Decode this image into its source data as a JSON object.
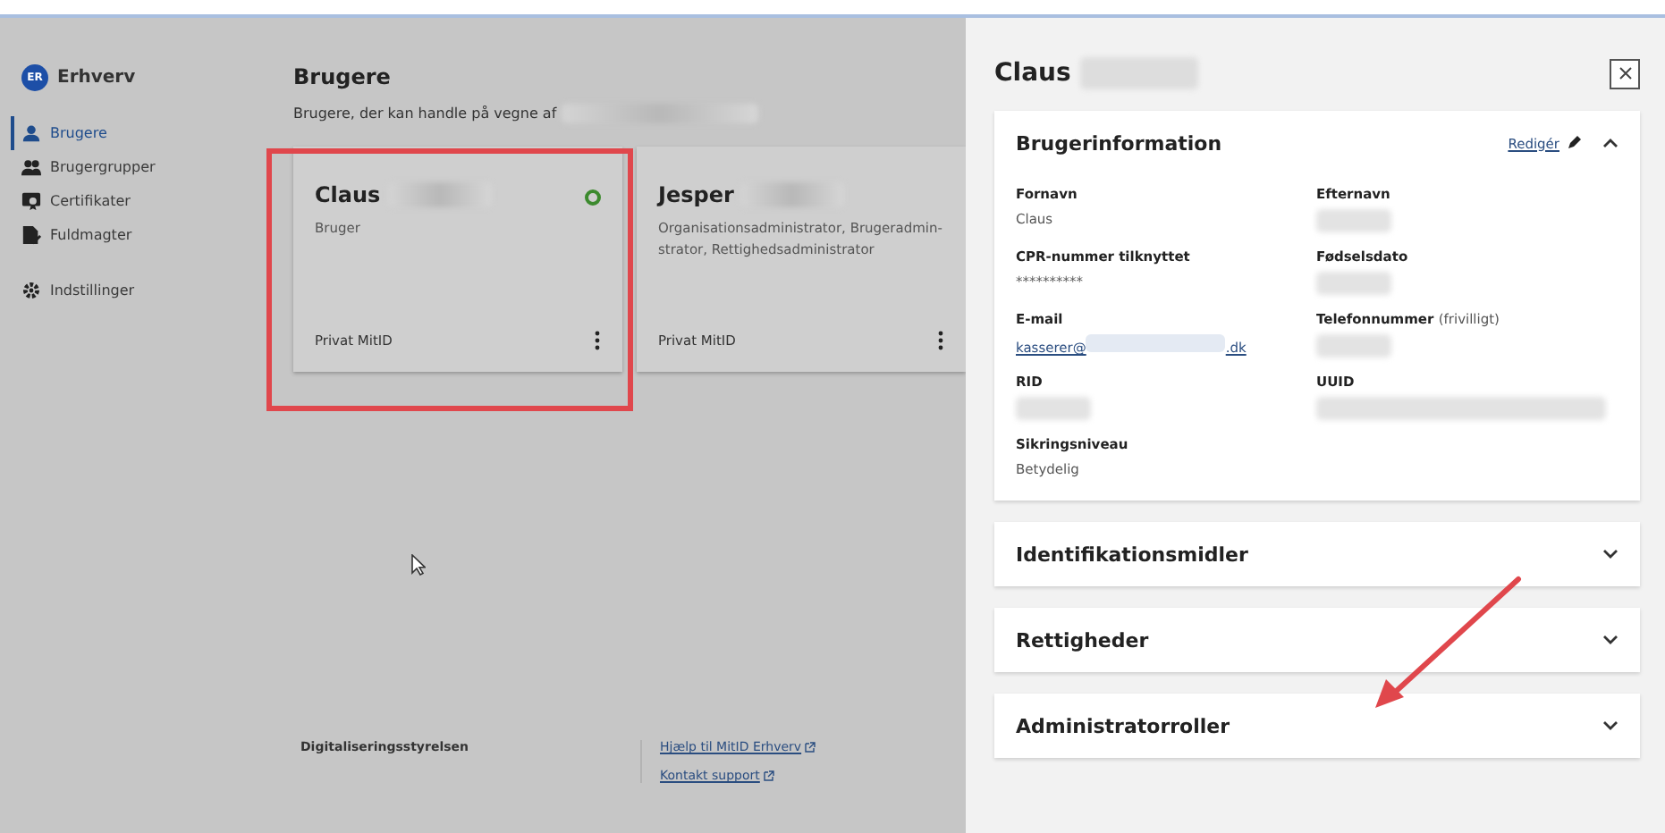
{
  "brand": {
    "name": "Erhverv",
    "badge": "ER"
  },
  "sidebar": {
    "items": [
      {
        "label": "Brugere",
        "selected": true
      },
      {
        "label": "Brugergrupper",
        "selected": false
      },
      {
        "label": "Certifikater",
        "selected": false
      },
      {
        "label": "Fuldmagter",
        "selected": false
      },
      {
        "label": "Indstillinger",
        "selected": false
      }
    ]
  },
  "main": {
    "title": "Brugere",
    "subtitle": "Brugere, der kan handle på vegne af",
    "cards": [
      {
        "name": "Claus",
        "roles": "Bruger",
        "id_type": "Privat MitID",
        "active": true,
        "highlighted": true
      },
      {
        "name": "Jesper",
        "roles": "Organisationsadministrator, Brugeradmin-strator, Rettighedsadministrator",
        "id_type": "Privat MitID",
        "active": false,
        "highlighted": false
      }
    ]
  },
  "footer": {
    "org": "Digitaliseringsstyrelsen",
    "links": [
      "Hjælp til MitID Erhverv",
      "Kontakt support"
    ]
  },
  "panel": {
    "title": "Claus",
    "sections": [
      {
        "title": "Brugerinformation",
        "expanded": true,
        "edit_label": "Redigér",
        "fields": [
          {
            "label": "Fornavn",
            "kind": "text",
            "value": "Claus"
          },
          {
            "label": "Efternavn",
            "kind": "redacted"
          },
          {
            "label": "CPR-nummer tilknyttet",
            "kind": "text",
            "value": "**********"
          },
          {
            "label": "Fødselsdato",
            "kind": "redacted"
          },
          {
            "label": "E-mail",
            "kind": "email",
            "prefix": "kasserer@",
            "suffix": ".dk"
          },
          {
            "label": "Telefonnummer",
            "note": "(frivilligt)",
            "kind": "redacted"
          },
          {
            "label": "RID",
            "kind": "redacted"
          },
          {
            "label": "UUID",
            "kind": "redacted_wide"
          },
          {
            "label": "Sikringsniveau",
            "kind": "text",
            "value": "Betydelig"
          }
        ]
      },
      {
        "title": "Identifikationsmidler",
        "expanded": false
      },
      {
        "title": "Rettigheder",
        "expanded": false
      },
      {
        "title": "Administratorroller",
        "expanded": false
      }
    ]
  }
}
